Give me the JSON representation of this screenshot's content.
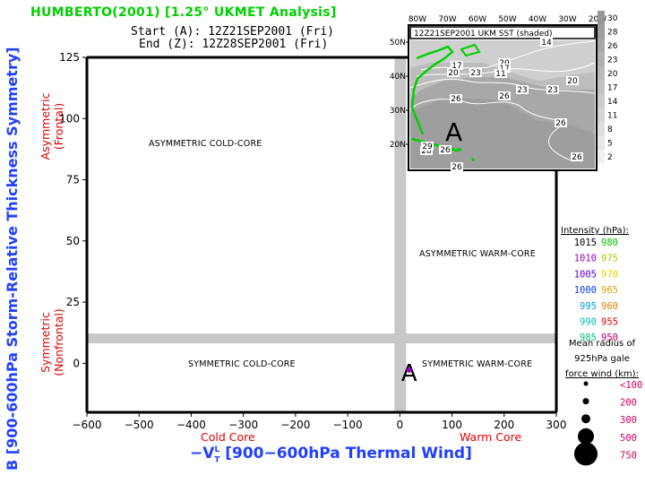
{
  "header": {
    "title": "HUMBERTO(2001) [1.25° UKMET Analysis]",
    "start_line": "Start (A): 12Z21SEP2001 (Fri)",
    "end_line": "End (Z): 12Z28SEP2001 (Fri)"
  },
  "chart_data": {
    "type": "scatter",
    "title": "HUMBERTO(2001) [1.25° UKMET Analysis]",
    "xlabel": "-V_T^L [900-600hPa Thermal Wind]",
    "ylabel": "B [900-600hPa Storm-Relative Thickness Symmetry]",
    "xlim": [
      -600,
      300
    ],
    "ylim": [
      -20,
      125
    ],
    "xticks": [
      -600,
      -500,
      -400,
      -300,
      -200,
      -100,
      0,
      100,
      200,
      300
    ],
    "yticks": [
      0,
      25,
      50,
      75,
      100,
      125
    ],
    "x_side_labels": {
      "left": "Cold Core",
      "right": "Warm Core"
    },
    "y_side_labels": {
      "top": "Asymmetric\n(Frontal)",
      "bottom": "Symmetric\n(Nonfrontal)"
    },
    "threshold_bands": {
      "x": 0,
      "y": 10
    },
    "quadrant_labels": [
      {
        "text": "ASYMMETRIC COLD-CORE",
        "position": "upper-left"
      },
      {
        "text": "ASYMMETRIC WARM-CORE",
        "position": "upper-right"
      },
      {
        "text": "SYMMETRIC COLD-CORE",
        "position": "lower-left"
      },
      {
        "text": "SYMMETRIC WARM-CORE",
        "position": "lower-right"
      }
    ],
    "points": [
      {
        "label": "A",
        "x": 18,
        "y": -2,
        "intensity_color": "#a000c0",
        "marker": "start"
      }
    ],
    "grid": false
  },
  "inset_map": {
    "title": "12Z21SEP2001 UKM SST (shaded)",
    "lon_labels": [
      "80W",
      "70W",
      "60W",
      "50W",
      "40W",
      "30W",
      "20W"
    ],
    "lat_labels": [
      "50N",
      "40N",
      "30N",
      "20N"
    ],
    "contour_labels": [
      "14",
      "17",
      "20",
      "23",
      "20",
      "17",
      "11",
      "23",
      "20",
      "26",
      "26",
      "23",
      "26",
      "26",
      "28",
      "29",
      "26",
      "26"
    ],
    "storm_marker": "A",
    "colorbar_values": [
      "30",
      "28",
      "26",
      "23",
      "20",
      "17",
      "14",
      "11",
      "8",
      "5",
      "2"
    ]
  },
  "legend": {
    "intensity_title": "Intensity (hPa):",
    "intensity": [
      {
        "left": "1015",
        "left_color": "#000000",
        "right": "980",
        "right_color": "#00c000"
      },
      {
        "left": "1010",
        "left_color": "#a000c0",
        "right": "975",
        "right_color": "#a0d000"
      },
      {
        "left": "1005",
        "left_color": "#6000e0",
        "right": "970",
        "right_color": "#e0d000"
      },
      {
        "left": "1000",
        "left_color": "#0040ff",
        "right": "965",
        "right_color": "#e0a000"
      },
      {
        "left": "995",
        "left_color": "#00a0e0",
        "right": "960",
        "right_color": "#e08000"
      },
      {
        "left": "990",
        "left_color": "#00c0c0",
        "right": "955",
        "right_color": "#e00000"
      },
      {
        "left": "985",
        "left_color": "#00c080",
        "right": "950",
        "right_color": "#c00060"
      }
    ],
    "radius_title_lines": [
      "Mean radius of",
      "925hPa gale",
      "force wind (km):"
    ],
    "radius": [
      {
        "label": "<100"
      },
      {
        "label": "200"
      },
      {
        "label": "300"
      },
      {
        "label": "500"
      },
      {
        "label": "750"
      }
    ],
    "radius_color": "#d00060"
  },
  "colors": {
    "title": "#00d000",
    "axis_label": "#2040ff",
    "side_label": "#e00000",
    "band": "#c8c8c8"
  }
}
